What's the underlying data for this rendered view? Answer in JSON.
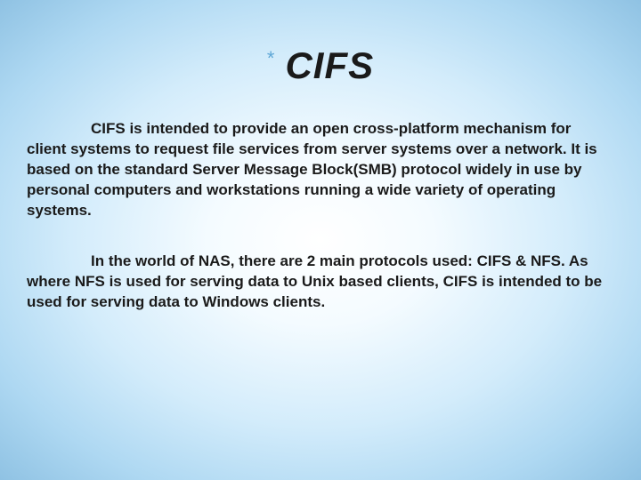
{
  "slide": {
    "title": "CIFS",
    "bullet_glyph": "*",
    "paragraphs": [
      "CIFS is intended to provide an open cross-platform mechanism for client systems to request file services from server systems over a network. It is based on the standard Server Message Block(SMB) protocol widely in use by personal computers and workstations running a wide variety of operating systems.",
      "In the world of NAS, there are 2 main protocols used: CIFS & NFS. As where NFS is used for serving data to Unix based clients, CIFS is intended to be used for serving data to Windows clients."
    ]
  }
}
